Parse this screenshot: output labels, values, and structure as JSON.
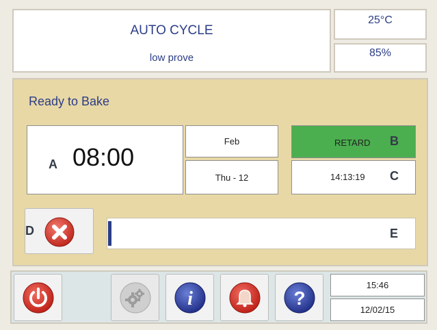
{
  "header": {
    "title": "AUTO CYCLE",
    "subtitle": "low prove",
    "temperature": "25°C",
    "humidity": "85%"
  },
  "panel": {
    "status": "Ready to Bake",
    "start_time": "08:00",
    "month": "Feb",
    "day": "Thu - 12",
    "mode_button": "RETARD",
    "current_time": "14:13:19",
    "progress_fraction": 0.01,
    "markers": {
      "a": "A",
      "b": "B",
      "c": "C",
      "d": "D",
      "e": "E"
    }
  },
  "toolbar": {
    "icons": [
      "power-icon",
      "settings-gear-icon",
      "info-icon",
      "alarm-bell-icon",
      "help-icon"
    ],
    "time": "15:46",
    "date": "12/02/15"
  },
  "colors": {
    "panel_bg": "#e8d8a6",
    "retard_green": "#4bae4f",
    "title_blue": "#2b3d86",
    "bottom_bg": "#dde6e6"
  }
}
